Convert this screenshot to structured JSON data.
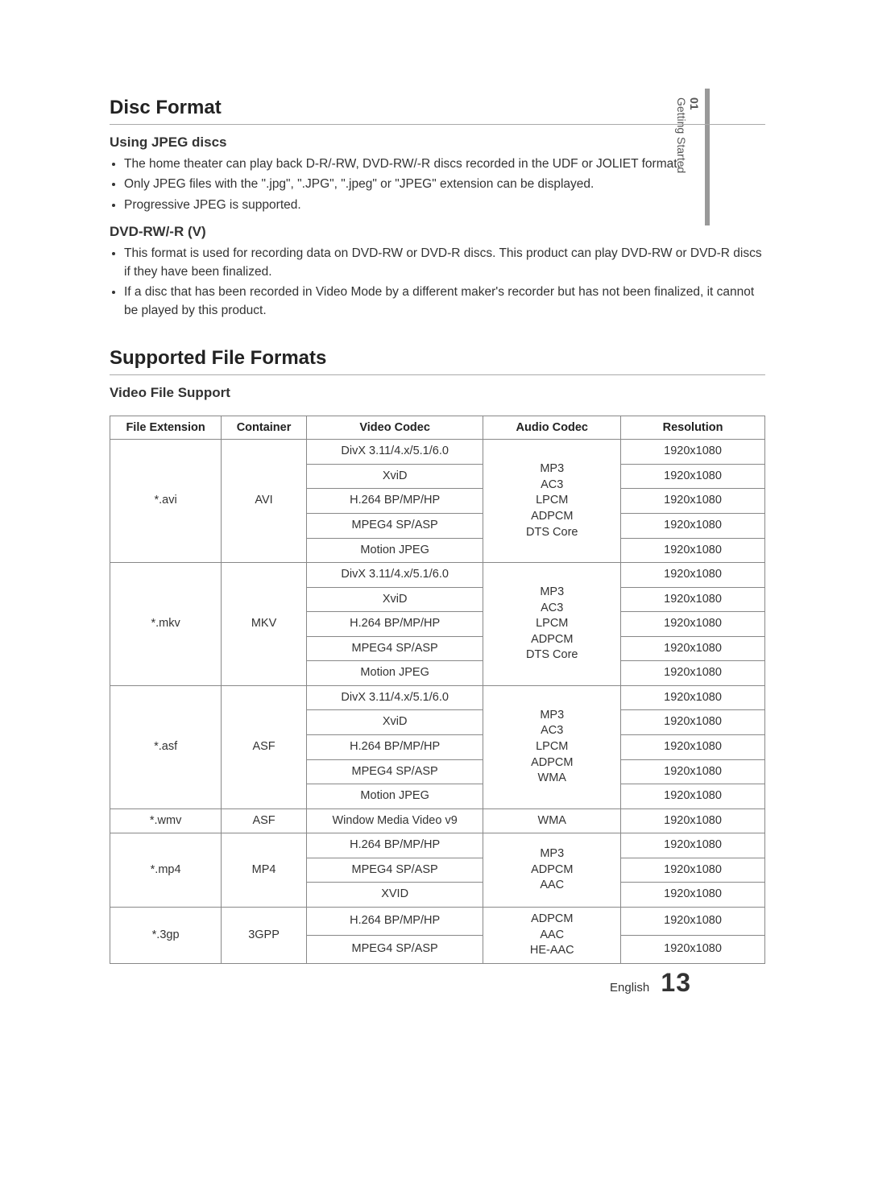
{
  "sidetab": {
    "num": "01",
    "label": "Getting Started"
  },
  "sections": {
    "disc": {
      "title": "Disc Format",
      "jpeg": {
        "heading": "Using JPEG discs",
        "b1": "The home theater can play back D-R/-RW, DVD-RW/-R discs recorded in the UDF or JOLIET format.",
        "b2": "Only JPEG files with the \".jpg\", \".JPG\", \".jpeg\" or \"JPEG\" extension can be displayed.",
        "b3": "Progressive JPEG is supported."
      },
      "dvdrw": {
        "heading": "DVD-RW/-R (V)",
        "b1": "This format is used for recording data on DVD-RW or DVD-R discs. This product can play DVD-RW or DVD-R discs if they have been finalized.",
        "b2": "If a disc that has been recorded in Video Mode by a different maker's recorder but has not been finalized, it cannot be played by this product."
      }
    },
    "supported": {
      "title": "Supported File Formats",
      "subhead": "Video File Support"
    }
  },
  "table": {
    "headers": {
      "ext": "File Extension",
      "container": "Container",
      "vcodec": "Video Codec",
      "acodec": "Audio Codec",
      "res": "Resolution"
    },
    "res": "1920x1080",
    "vcodecs5": {
      "c1": "DivX 3.11/4.x/5.1/6.0",
      "c2": "XviD",
      "c3": "H.264 BP/MP/HP",
      "c4": "MPEG4 SP/ASP",
      "c5": "Motion JPEG"
    },
    "acodecs5": "MP3\nAC3\nLPCM\nADPCM\nDTS Core",
    "acodecs_asf": "MP3\nAC3\nLPCM\nADPCM\nWMA",
    "rows": {
      "avi": {
        "ext": "*.avi",
        "container": "AVI"
      },
      "mkv": {
        "ext": "*.mkv",
        "container": "MKV"
      },
      "asf": {
        "ext": "*.asf",
        "container": "ASF"
      },
      "wmv": {
        "ext": "*.wmv",
        "container": "ASF",
        "vcodec": "Window Media Video v9",
        "acodec": "WMA"
      },
      "mp4": {
        "ext": "*.mp4",
        "container": "MP4",
        "v1": "H.264 BP/MP/HP",
        "v2": "MPEG4 SP/ASP",
        "v3": "XVID",
        "acodec": "MP3\nADPCM\nAAC"
      },
      "tgp": {
        "ext": "*.3gp",
        "container": "3GPP",
        "v1": "H.264 BP/MP/HP",
        "v2": "MPEG4 SP/ASP",
        "acodec": "ADPCM\nAAC\nHE-AAC"
      }
    }
  },
  "footer": {
    "lang": "English",
    "page": "13"
  }
}
